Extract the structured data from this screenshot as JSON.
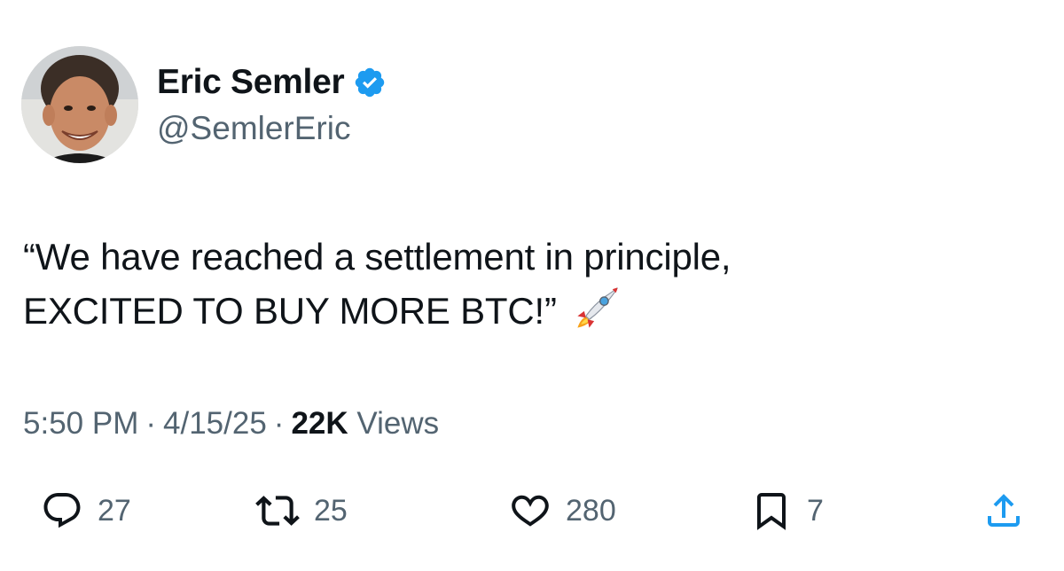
{
  "author": {
    "display_name": "Eric Semler",
    "handle": "@SemlerEric",
    "verified": true,
    "verified_color": "#1d9bf0"
  },
  "tweet": {
    "text_line1": "“We have reached a settlement in principle,",
    "text_line2": "EXCITED TO BUY MORE BTC!”",
    "emoji": "rocket-icon"
  },
  "meta": {
    "time": "5:50 PM",
    "separator": "·",
    "date": "4/15/25",
    "views_count": "22K",
    "views_label": "Views"
  },
  "actions": {
    "reply_count": "27",
    "retweet_count": "25",
    "like_count": "280",
    "bookmark_count": "7"
  },
  "colors": {
    "text_primary": "#0f1419",
    "text_secondary": "#536471",
    "accent": "#1d9bf0"
  }
}
